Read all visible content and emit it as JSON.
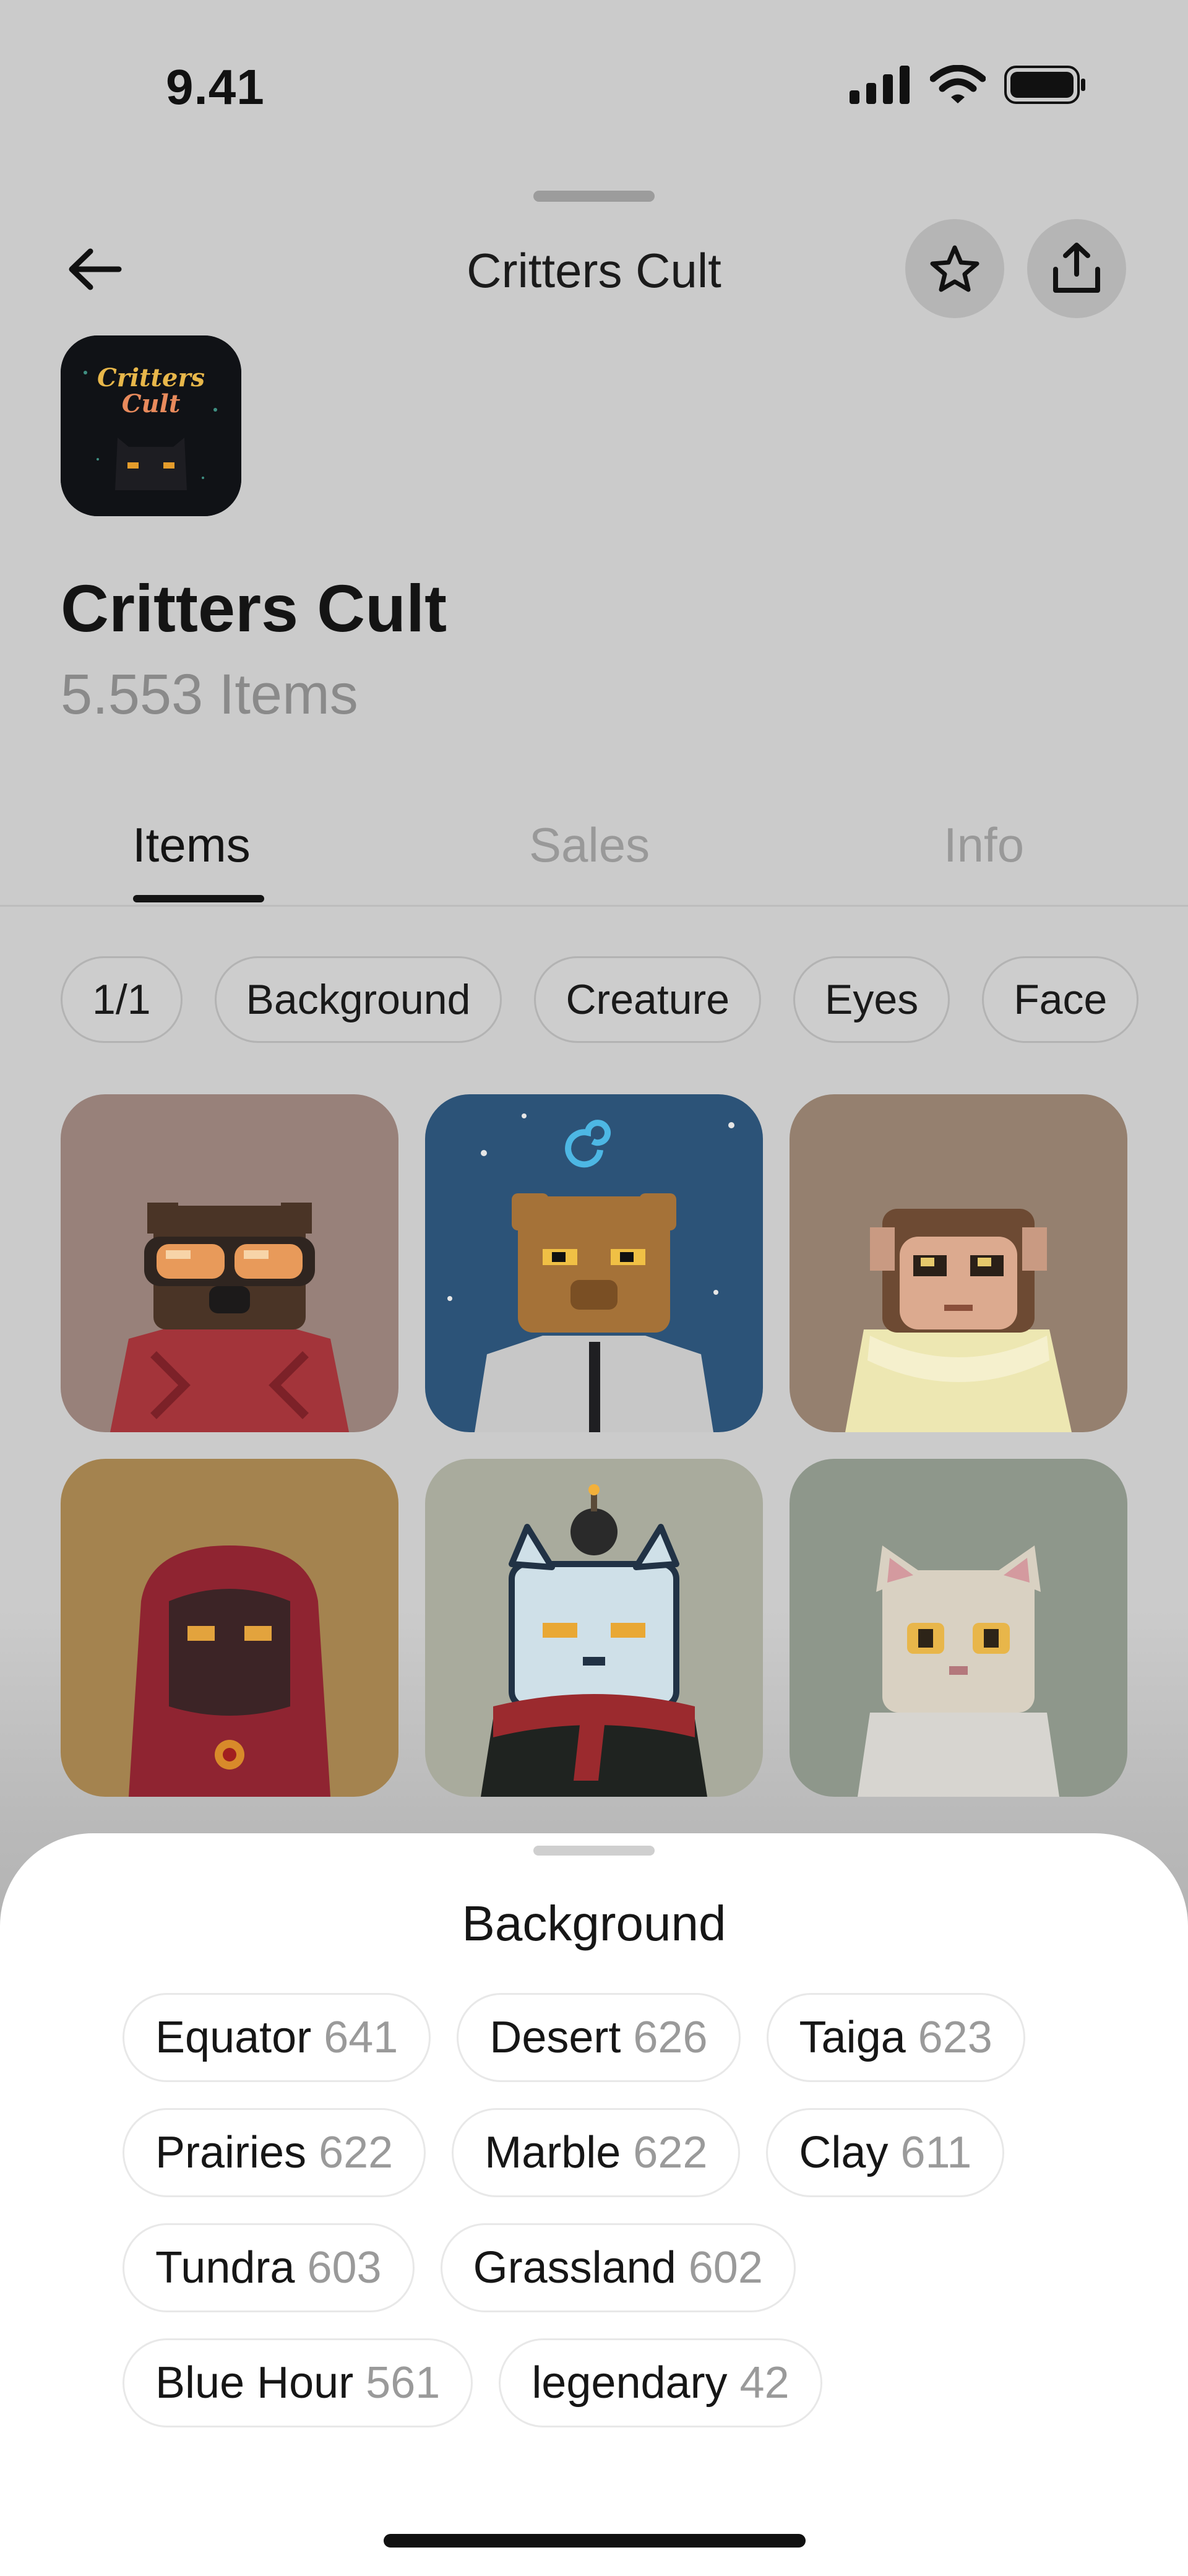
{
  "status_bar": {
    "time": "9.41",
    "icons": [
      "signal-icon",
      "wifi-icon",
      "battery-icon"
    ]
  },
  "nav": {
    "title": "Critters Cult",
    "back_icon": "arrow-left-icon",
    "star_icon": "star-icon",
    "share_icon": "share-icon"
  },
  "collection": {
    "name": "Critters Cult",
    "item_count": "5.553 Items",
    "logo_text": "Critters Cult"
  },
  "tabs": [
    {
      "label": "Items",
      "active": true
    },
    {
      "label": "Sales",
      "active": false
    },
    {
      "label": "Info",
      "active": false
    }
  ],
  "filters": [
    "1/1",
    "Background",
    "Creature",
    "Eyes",
    "Face"
  ],
  "grid_items": [
    {
      "name": "critter-goggles",
      "background": "#98817a"
    },
    {
      "name": "critter-bear-space",
      "background": "#2c5378"
    },
    {
      "name": "critter-monkey-scarf",
      "background": "#95806f"
    },
    {
      "name": "critter-hooded",
      "background": "#a4834f"
    },
    {
      "name": "critter-cat-bomb",
      "background": "#a9ab9d"
    },
    {
      "name": "critter-cat-white",
      "background": "#8e978b"
    }
  ],
  "sheet": {
    "title": "Background",
    "options": [
      [
        {
          "label": "Equator",
          "count": "641"
        },
        {
          "label": "Desert",
          "count": "626"
        },
        {
          "label": "Taiga",
          "count": "623"
        }
      ],
      [
        {
          "label": "Prairies",
          "count": "622"
        },
        {
          "label": "Marble",
          "count": "622"
        },
        {
          "label": "Clay",
          "count": "611"
        }
      ],
      [
        {
          "label": "Tundra",
          "count": "603"
        },
        {
          "label": "Grassland",
          "count": "602"
        }
      ],
      [
        {
          "label": "Blue Hour",
          "count": "561"
        },
        {
          "label": "legendary",
          "count": "42"
        }
      ]
    ]
  },
  "colors": {
    "accent": "#141414",
    "muted": "#999999",
    "sheet_bg": "#ffffff"
  }
}
